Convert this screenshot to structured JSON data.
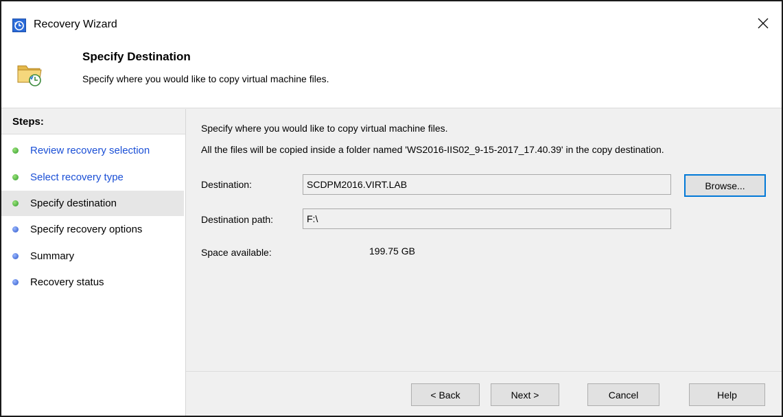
{
  "window": {
    "title": "Recovery Wizard",
    "close_symbol": "✕",
    "title_icon": "clock-history-icon"
  },
  "header": {
    "title": "Specify Destination",
    "subtitle": "Specify where you would like to copy virtual machine files.",
    "icon": "folder-restore-icon"
  },
  "steps": {
    "title": "Steps:",
    "items": [
      {
        "label": "Review recovery selection",
        "state": "completed",
        "dot_color": "#2f9a2a"
      },
      {
        "label": "Select recovery type",
        "state": "completed",
        "dot_color": "#2f9a2a"
      },
      {
        "label": "Specify destination",
        "state": "current",
        "dot_color": "#2f9a2a"
      },
      {
        "label": "Specify recovery options",
        "state": "pending",
        "dot_color": "#2b56c9"
      },
      {
        "label": "Summary",
        "state": "pending",
        "dot_color": "#2b56c9"
      },
      {
        "label": "Recovery status",
        "state": "pending",
        "dot_color": "#2b56c9"
      }
    ]
  },
  "main": {
    "instruction": "Specify where you would like to copy virtual machine files.",
    "folder_note": "All the files will be copied inside a folder named 'WS2016-IIS02_9-15-2017_17.40.39' in the copy destination.",
    "destination_label": "Destination:",
    "destination_value": "SCDPM2016.VIRT.LAB",
    "browse_label": "Browse...",
    "path_label": "Destination path:",
    "path_value": "F:\\",
    "space_label": "Space available:",
    "space_value": "199.75 GB"
  },
  "footer": {
    "back_label": "< Back",
    "next_label": "Next >",
    "cancel_label": "Cancel",
    "help_label": "Help"
  },
  "colors": {
    "link": "#1a4fd6",
    "focus_border": "#0078d7",
    "current_step_bg": "#e6e6e6"
  }
}
